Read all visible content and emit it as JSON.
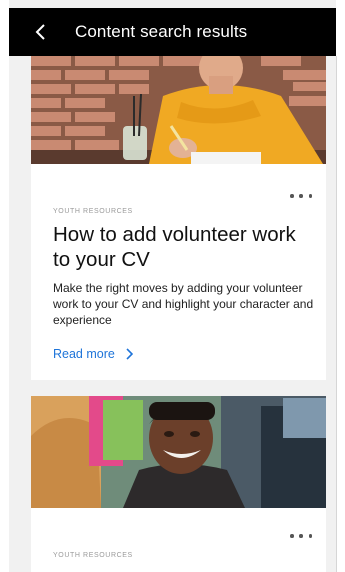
{
  "header": {
    "title": "Content search results",
    "back_icon": "chevron-left-icon"
  },
  "articles": [
    {
      "category": "YOUTH RESOURCES",
      "title": "How to add volunteer work to your CV",
      "summary": "Make the right moves by adding your volunteer work to your CV and highlight your character and experience",
      "read_more": "Read more",
      "image": "woman-writing-photo"
    },
    {
      "category": "YOUTH RESOURCES",
      "image": "smiling-young-man-photo"
    }
  ],
  "colors": {
    "appbar": "#000000",
    "link": "#1e74d9",
    "accent": "#f0b400"
  }
}
